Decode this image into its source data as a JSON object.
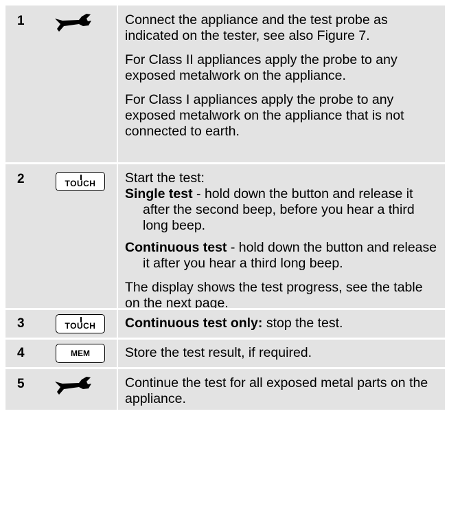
{
  "steps": [
    {
      "number": "1",
      "icon": "wrench-icon",
      "paragraphs": [
        "Connect the appliance and the test probe as indicated on the tester, see also Figure 7.",
        "For Class II appliances apply the probe to any exposed metalwork on the appliance.",
        "For Class I appliances apply the probe to any exposed metalwork on the appliance that is not connected to earth."
      ]
    },
    {
      "number": "2",
      "button_label": "TOUCH",
      "intro": "Start the test:",
      "single_label": "Single test",
      "single_text": " - hold down the button and release it after the second beep, before you hear a third long beep.",
      "continuous_label": "Continuous test",
      "continuous_text": " - hold down the button and release it after you hear a third long beep.",
      "footer": "The display shows the test progress, see the table on the next page."
    },
    {
      "number": "3",
      "button_label": "TOUCH",
      "bold_text": "Continuous test only:",
      "text": " stop the test."
    },
    {
      "number": "4",
      "button_label": "MEM",
      "text": "Store the test result, if required."
    },
    {
      "number": "5",
      "icon": "wrench-icon",
      "text": "Continue the test for all exposed metal parts on the appliance."
    }
  ]
}
